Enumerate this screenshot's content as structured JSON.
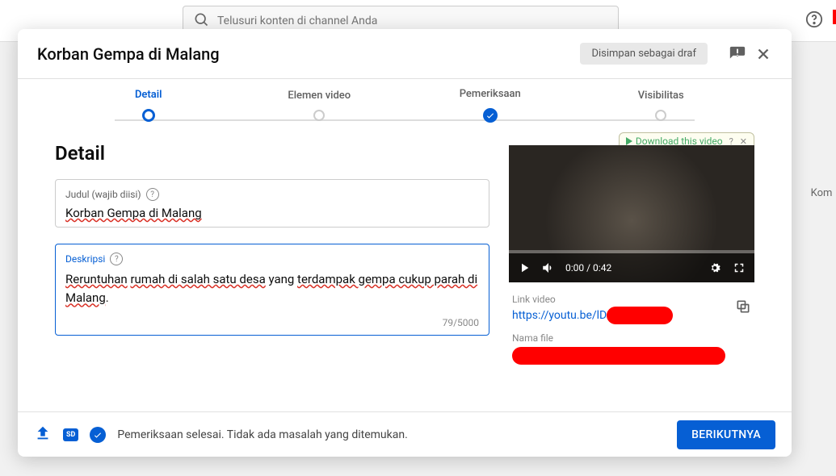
{
  "topbar": {
    "search_placeholder": "Telusuri konten di channel Anda"
  },
  "modal": {
    "title": "Korban Gempa di Malang",
    "draft_status": "Disimpan sebagai draf"
  },
  "stepper": {
    "steps": [
      {
        "label": "Detail"
      },
      {
        "label": "Elemen video"
      },
      {
        "label": "Pemeriksaan"
      },
      {
        "label": "Visibilitas"
      }
    ]
  },
  "detail": {
    "heading": "Detail",
    "title_field": {
      "label": "Judul (wajib diisi)",
      "value": "Korban Gempa di Malang"
    },
    "desc_field": {
      "label": "Deskripsi",
      "value_seg1": "Reruntuhan",
      "value_seg2": "rumah di salah satu desa",
      "value_seg3": " yang ",
      "value_seg4": "terdampak gempa cukup parah di Malang",
      "value_seg5": ".",
      "counter": "79/5000"
    }
  },
  "preview": {
    "download_text": "Download this video",
    "time": "0:00 / 0:42"
  },
  "meta": {
    "link_label": "Link video",
    "link_prefix": "https://youtu.be/lD",
    "file_label": "Nama file"
  },
  "footer": {
    "hd": "SD",
    "status": "Pemeriksaan selesai. Tidak ada masalah yang ditemukan.",
    "next": "BERIKUTNYA"
  },
  "background": {
    "tab_stub": "Kom"
  }
}
